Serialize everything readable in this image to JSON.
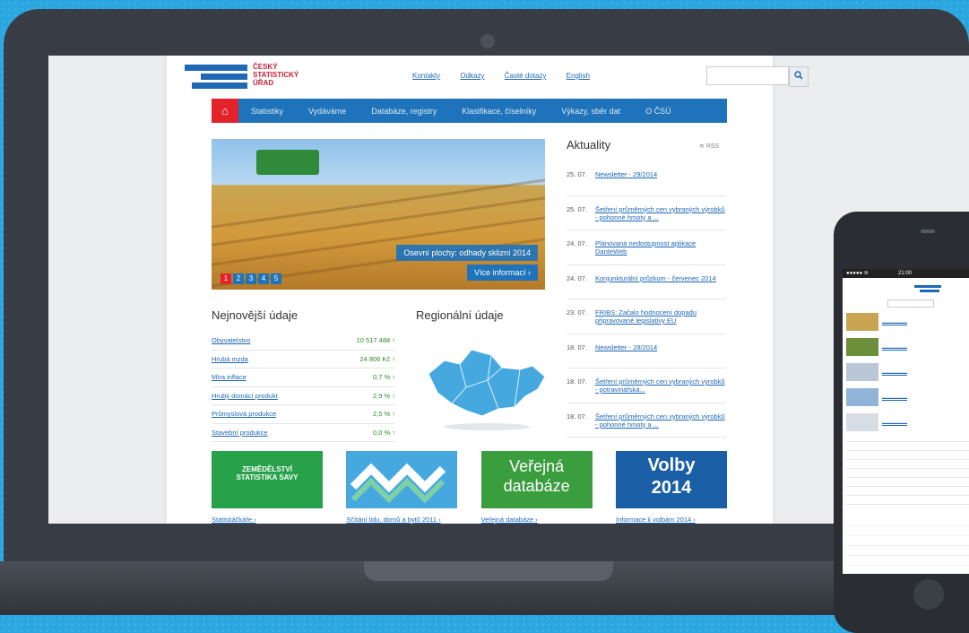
{
  "site": {
    "logo_text": "ČESKÝ\nSTATISTICKÝ\nÚŘAD",
    "top_links": [
      "Kontakty",
      "Odkazy",
      "Časté dotazy",
      "English"
    ],
    "nav": [
      "Statistiky",
      "Vydáváme",
      "Databáze, registry",
      "Klasifikace, číselníky",
      "Výkazy, sběr dat",
      "O ČSÚ"
    ],
    "hero": {
      "caption": "Osevní plochy: odhady sklizní 2014",
      "more": "Více informací ›",
      "pager": [
        "1",
        "2",
        "3",
        "4",
        "5"
      ]
    },
    "latest_title": "Nejnovější údaje",
    "latest": [
      {
        "label": "Obyvatelstvo",
        "value": "10 517 488 ↑"
      },
      {
        "label": "Hrubá mzda",
        "value": "24 806 Kč ↑"
      },
      {
        "label": "Míra inflace",
        "value": "0,7 % ↑"
      },
      {
        "label": "Hrubý domácí produkt",
        "value": "2,9 % ↑"
      },
      {
        "label": "Průmyslová produkce",
        "value": "2,5 % ↑"
      },
      {
        "label": "Stavební produkce",
        "value": "0,0 % ↑"
      }
    ],
    "regional_title": "Regionální údaje",
    "news_title": "Aktuality",
    "rss": "RSS",
    "news": [
      {
        "date": "25. 07.",
        "title": "Newsletter - 29/2014"
      },
      {
        "date": "25. 07.",
        "title": "Šetření průměrných cen vybraných výrobků - pohonné hmoty a ..."
      },
      {
        "date": "24. 07.",
        "title": "Plánovaná nedostupnost aplikace DanteWeb"
      },
      {
        "date": "24. 07.",
        "title": "Konjunkturální průzkum - červenec 2014"
      },
      {
        "date": "23. 07.",
        "title": "FRIBS: Začalo hodnocení dopadu připravované legislativy EU"
      },
      {
        "date": "18. 07.",
        "title": "Newsletter - 28/2014"
      },
      {
        "date": "18. 07.",
        "title": "Šetření průměrných cen vybraných výrobků - potravinářská..."
      },
      {
        "date": "18. 07.",
        "title": "Šetření průměrných cen vybraných výrobků - pohonné hmoty a ..."
      }
    ],
    "banners": [
      {
        "image_text": "ZEMĚDĚLSTVÍ\nSTATISTIKA SAVY",
        "caption": "Statistiáčkáře ›",
        "color": "#27a14a"
      },
      {
        "image_text": "",
        "caption": "Sčítání lidu, domů a bytů 2011 ›",
        "color": "#45a9e0"
      },
      {
        "image_text": "Veřejná\ndatabáze",
        "caption": "Veřejná databáze ›",
        "color": "#3a9e3e"
      },
      {
        "image_text": "Volby\n2014",
        "caption": "Informace k volbám 2014 ›",
        "color": "#1a5fa6"
      }
    ]
  },
  "phone": {
    "status": "●●●●● ≋",
    "time": "21:00"
  },
  "colors": {
    "brand_blue": "#1f73ba",
    "brand_red": "#e4222b",
    "link": "#1f68b4",
    "value_green": "#2b8a2b"
  }
}
